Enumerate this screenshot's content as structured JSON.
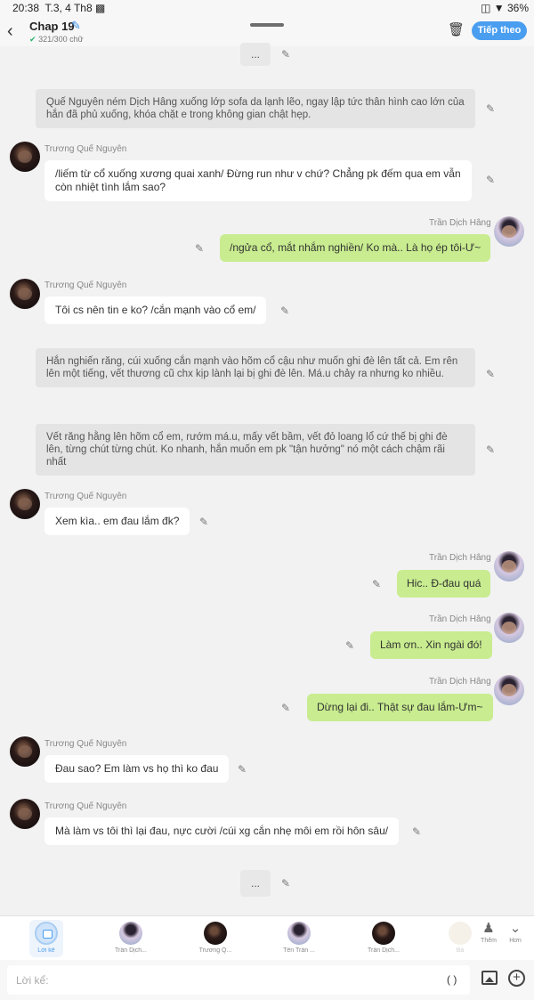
{
  "status": {
    "time": "20:38",
    "date": "T.3, 4 Th8",
    "battery": "36%"
  },
  "header": {
    "title": "Chap 19",
    "word_count": "321/300 chữ",
    "follow_label": "Tiếp theo"
  },
  "feed": {
    "top_ellipsis": "...",
    "messages": [
      {
        "type": "narration",
        "text": "Quế Nguyên ném Dịch Hâng xuống lớp sofa da lạnh lẽo, ngay lập tức thân hình cao lớn của hắn đã phủ xuống, khóa chặt e trong không gian chật hẹp."
      },
      {
        "type": "left",
        "speaker": "Trương Quế Nguyên",
        "text": "/liếm từ cổ xuống xương quai xanh/ Đừng run như v chứ? Chẳng pk đếm qua em vẫn còn nhiệt tình lắm sao?"
      },
      {
        "type": "right",
        "speaker": "Trần Dịch Hâng",
        "text": "/ngửa cổ, mắt nhắm nghiền/ Ko mà.. Là họ ép tôi-Ư~"
      },
      {
        "type": "left",
        "speaker": "Trương Quế Nguyên",
        "text": "Tôi cs nên tin e ko? /cắn mạnh vào cổ em/"
      },
      {
        "type": "narration",
        "text": "Hắn nghiến răng, cúi xuống cắn mạnh vào hõm cổ cậu như muốn ghi đè lên tất cả. Em rên lên một tiếng, vết thương cũ chx kịp lành lại bị ghi đè lên. Má.u chảy ra nhưng ko nhiều."
      },
      {
        "type": "narration",
        "text": "Vết răng hằng lên hõm cổ em, rướm má.u, mấy vết bầm, vết đỏ loang lổ cứ thế bị ghi đè lên, từng chút từng chút. Ko nhanh, hắn muốn em pk \"tận hưởng\" nó một cách chậm rãi nhất"
      },
      {
        "type": "left",
        "speaker": "Trương Quế Nguyên",
        "text": "Xem kìa.. em đau lắm đk?"
      },
      {
        "type": "right",
        "speaker": "Trần Dịch Hâng",
        "text": "Hic.. Đ-đau quá"
      },
      {
        "type": "right",
        "speaker": "Trần Dịch Hâng",
        "text": "Làm ơn.. Xin ngài đó!"
      },
      {
        "type": "right",
        "speaker": "Trần Dịch Hâng",
        "text": "Dừng lại đi.. Thật sự đau lắm-Ưm~"
      },
      {
        "type": "left",
        "speaker": "Trương Quế Nguyên",
        "text": "Đau sao? Em làm vs họ thì ko đau"
      },
      {
        "type": "left",
        "speaker": "Trương Quế Nguyên",
        "text": "Mà làm vs tôi thì lại đau, nực cười /cúi xg cắn nhẹ môi em rồi hôn sâu/"
      }
    ],
    "bottom_ellipsis": "..."
  },
  "tabbar": {
    "tabs": [
      {
        "label": "Lời kể",
        "kind": "active"
      },
      {
        "label": "Trần Dịch...",
        "kind": "light"
      },
      {
        "label": "Trương Q...",
        "kind": "dark"
      },
      {
        "label": "Tên Trần ...",
        "kind": "light"
      },
      {
        "label": "Trần Dịch...",
        "kind": "dark"
      },
      {
        "label": "Bả",
        "kind": "faded"
      }
    ],
    "more_label": "Thêm",
    "less_label": "Hơn"
  },
  "input": {
    "placeholder": "Lời kể:",
    "paren": "( )"
  }
}
